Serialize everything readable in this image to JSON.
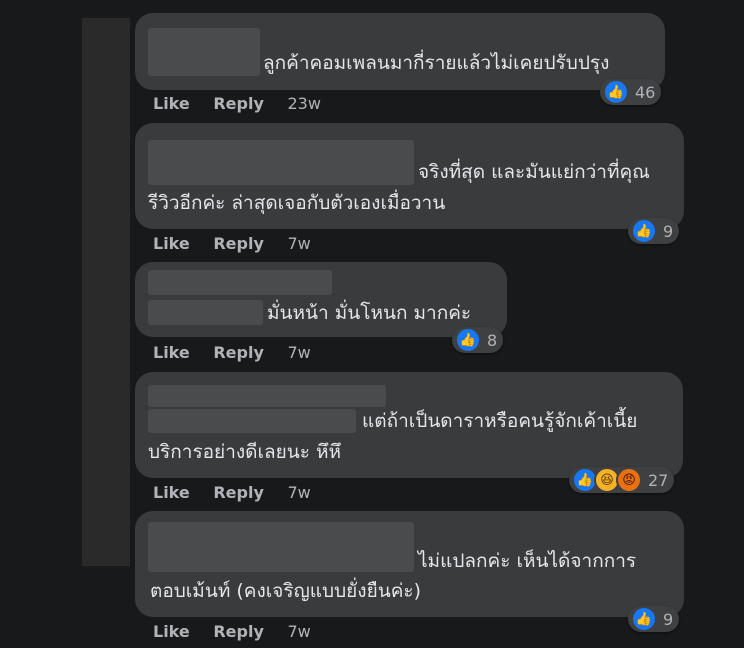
{
  "actions": {
    "like": "Like",
    "reply": "Reply"
  },
  "comments": [
    {
      "lines": [
        "ลูกค้าคอมเพลนมากี่รายแล้วไม่เคยปรับปรุง"
      ],
      "time": "23w",
      "reactions": [
        "like-icon"
      ],
      "count": "46"
    },
    {
      "lines": [
        "จริงที่สุด และมันแย่กว่าที่คุณ",
        "รีวิวอีกค่ะ ล่าสุดเจอกับตัวเองเมื่อวาน"
      ],
      "time": "7w",
      "reactions": [
        "like-icon"
      ],
      "count": "9"
    },
    {
      "lines": [
        "มั่นหน้า มั่นโหนก มากค่ะ"
      ],
      "time": "7w",
      "reactions": [
        "like-icon"
      ],
      "count": "8"
    },
    {
      "lines": [
        "แต่ถ้าเป็นดาราหรือคนรู้จักเค้าเนี้ย",
        "บริการอย่างดีเลยนะ หึหึ"
      ],
      "time": "7w",
      "reactions": [
        "like-icon",
        "haha-icon",
        "angry-icon"
      ],
      "count": "27"
    },
    {
      "lines": [
        "ไม่แปลกค่ะ เห็นได้จากการ",
        "ตอบเม้นท์ (คงเจริญแบบยั่งยืนค่ะ)"
      ],
      "time": "7w",
      "reactions": [
        "like-icon"
      ],
      "count": "9"
    }
  ]
}
